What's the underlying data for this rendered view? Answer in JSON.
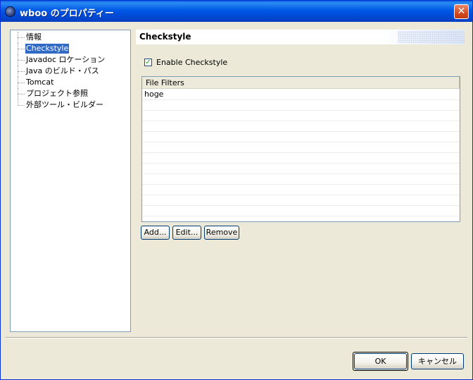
{
  "window": {
    "title": "wboo のプロパティー"
  },
  "tree": {
    "items": [
      {
        "label": "情報"
      },
      {
        "label": "Checkstyle"
      },
      {
        "label": "Javadoc ロケーション"
      },
      {
        "label": "Java のビルド・パス"
      },
      {
        "label": "Tomcat"
      },
      {
        "label": "プロジェクト参照"
      },
      {
        "label": "外部ツール・ビルダー"
      }
    ]
  },
  "page": {
    "title": "Checkstyle",
    "enable_checkbox": {
      "label": "Enable Checkstyle",
      "checked": true
    },
    "file_filters": {
      "header": "File Filters",
      "rows": [
        "hoge"
      ]
    },
    "buttons": {
      "add": "Add...",
      "edit": "Edit...",
      "remove": "Remove"
    }
  },
  "dialog_buttons": {
    "ok": "OK",
    "cancel": "キャンセル"
  }
}
